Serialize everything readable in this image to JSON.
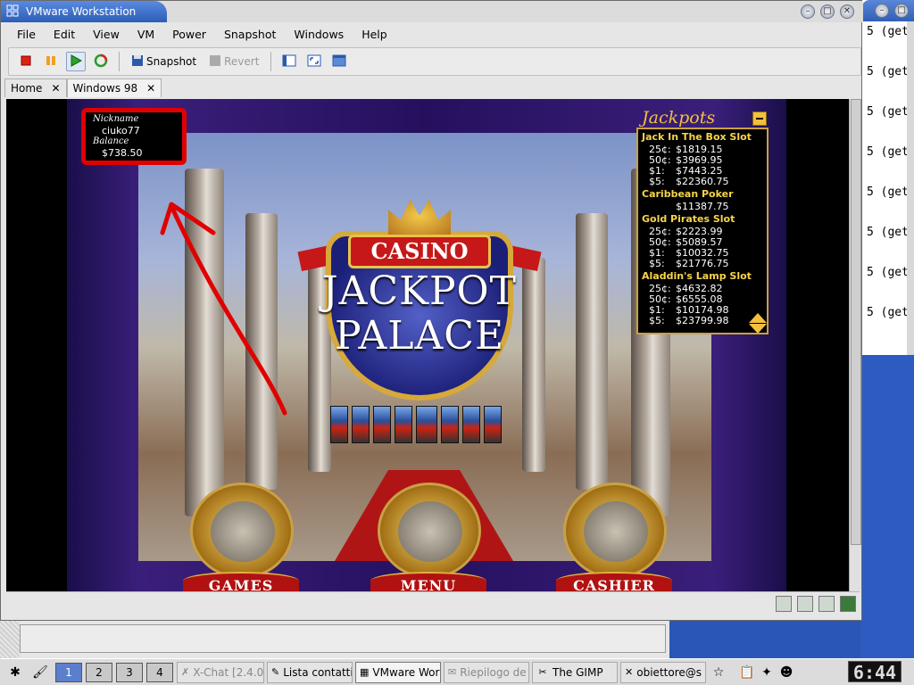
{
  "window": {
    "title": "VMware Workstation"
  },
  "menu": [
    "File",
    "Edit",
    "View",
    "VM",
    "Power",
    "Snapshot",
    "Windows",
    "Help"
  ],
  "toolbar": {
    "snapshot_label": "Snapshot",
    "revert_label": "Revert"
  },
  "tabs": [
    {
      "label": "Home"
    },
    {
      "label": "Windows 98"
    }
  ],
  "terminal_lines": [
    "5 (get",
    "5 (get",
    "5 (get",
    "5 (get",
    "5 (get",
    "5 (get",
    "5 (get",
    "5 (get"
  ],
  "casino": {
    "banner": "CASINO",
    "logo_line1": "JACKPOT",
    "logo_line2": "PALACE",
    "user": {
      "nickname_label": "Nickname",
      "nickname": "ciuko77",
      "balance_label": "Balance",
      "balance": "$738.50"
    },
    "buttons": {
      "games": "GAMES",
      "menu": "MENU",
      "cashier": "CASHIER"
    },
    "jackpots": {
      "title": "Jackpots",
      "games": [
        {
          "name": "Jack In The Box Slot",
          "rows": [
            {
              "d": "25¢:",
              "v": "$1819.15"
            },
            {
              "d": "50¢:",
              "v": "$3969.95"
            },
            {
              "d": "$1:",
              "v": "$7443.25"
            },
            {
              "d": "$5:",
              "v": "$22360.75"
            }
          ]
        },
        {
          "name": "Caribbean Poker",
          "rows": [
            {
              "d": "",
              "v": "$11387.75"
            }
          ]
        },
        {
          "name": "Gold Pirates Slot",
          "rows": [
            {
              "d": "25¢:",
              "v": "$2223.99"
            },
            {
              "d": "50¢:",
              "v": "$5089.57"
            },
            {
              "d": "$1:",
              "v": "$10032.75"
            },
            {
              "d": "$5:",
              "v": "$21776.75"
            }
          ]
        },
        {
          "name": "Aladdin's Lamp Slot",
          "rows": [
            {
              "d": "25¢:",
              "v": "$4632.82"
            },
            {
              "d": "50¢:",
              "v": "$6555.08"
            },
            {
              "d": "$1:",
              "v": "$10174.98"
            },
            {
              "d": "$5:",
              "v": "$23799.98"
            }
          ]
        }
      ]
    }
  },
  "taskbar": {
    "pager": [
      "1",
      "2",
      "3",
      "4"
    ],
    "tasks": [
      "X-Chat [2.4.0",
      "Lista contatti",
      "VMware Wor",
      "Riepilogo de",
      "The GIMP",
      "obiettore@s"
    ],
    "clock": "6:44"
  }
}
